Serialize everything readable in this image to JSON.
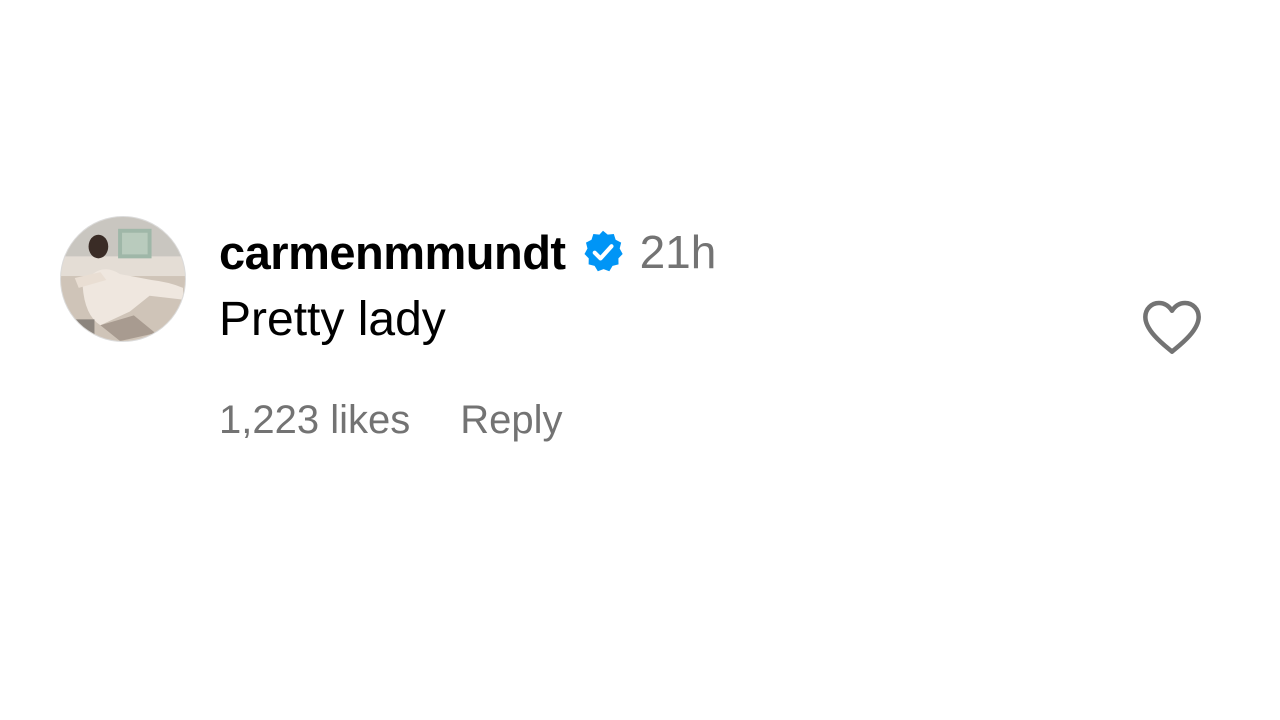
{
  "comment": {
    "username": "carmenmmundt",
    "verified": true,
    "timestamp": "21h",
    "text": "Pretty lady",
    "likes": "1,223 likes",
    "reply_label": "Reply"
  },
  "icons": {
    "verified": "verified-badge-icon",
    "like": "heart-outline-icon"
  },
  "colors": {
    "text_primary": "#000000",
    "text_secondary": "#737373",
    "verified_blue": "#0095f6",
    "background": "#ffffff"
  }
}
